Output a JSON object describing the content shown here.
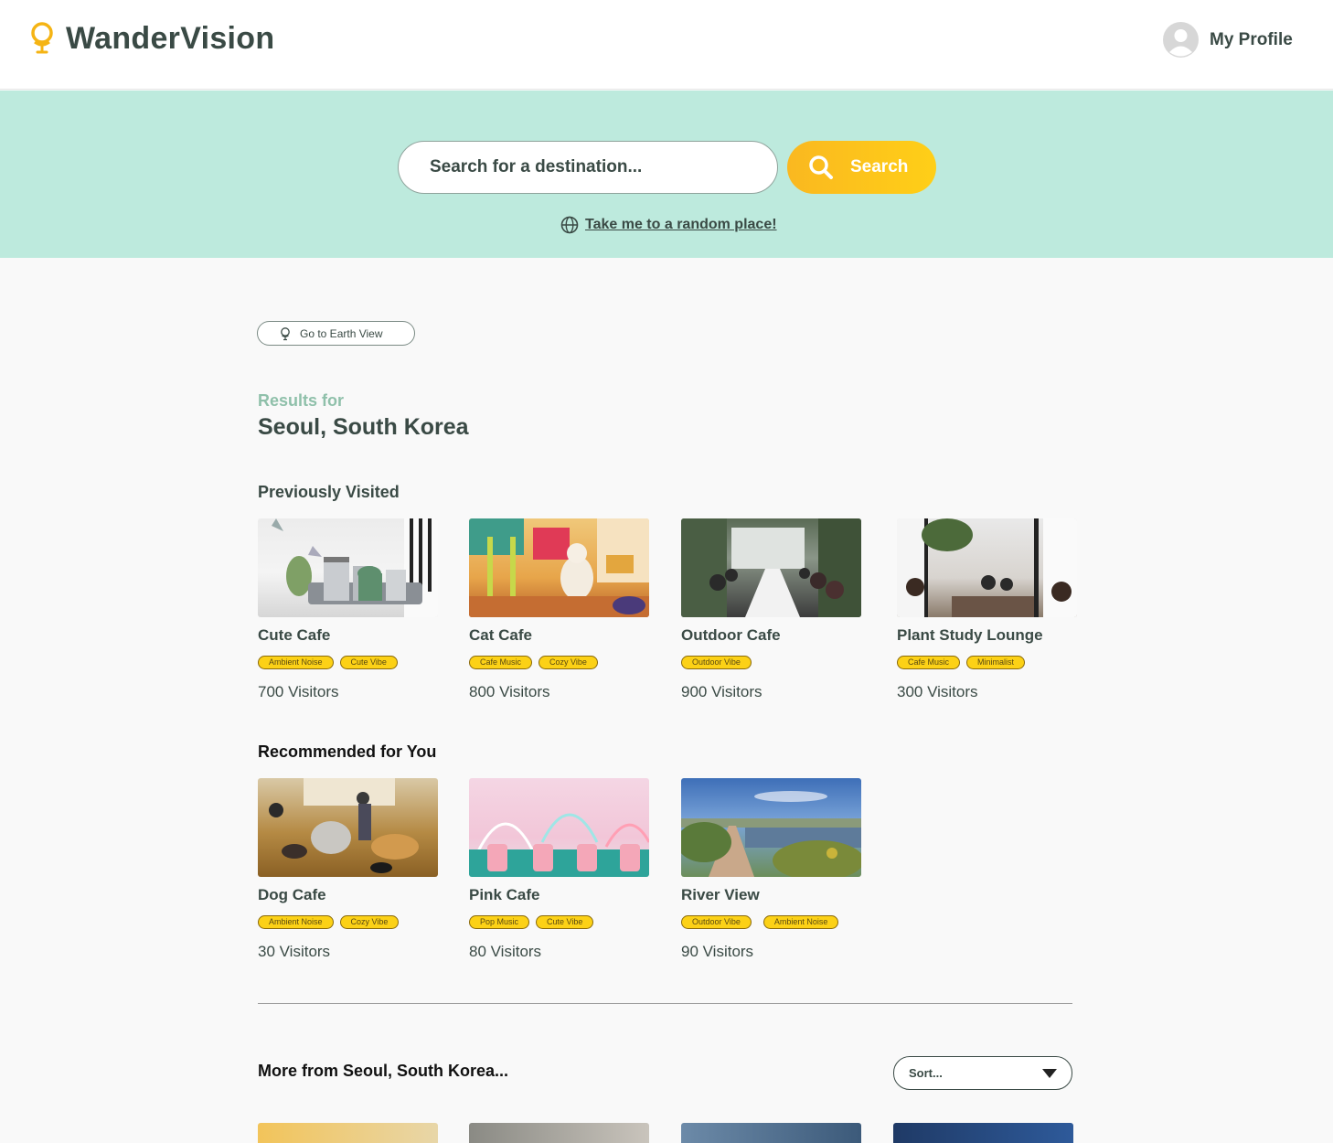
{
  "app": {
    "title": "WanderVision"
  },
  "profile": {
    "label": "My Profile"
  },
  "search": {
    "placeholder": "Search for a destination...",
    "button_label": "Search"
  },
  "random_link": {
    "label": "Take me to a random place!"
  },
  "earth_view": {
    "label": "Go to Earth View"
  },
  "results": {
    "prefix": "Results for",
    "location": "Seoul, South Korea"
  },
  "sections": {
    "previously_visited": {
      "title": "Previously Visited",
      "items": [
        {
          "name": "Cute Cafe",
          "tags": [
            "Ambient Noise",
            "Cute Vibe"
          ],
          "visitors": "700 Visitors"
        },
        {
          "name": "Cat Cafe",
          "tags": [
            "Cafe Music",
            "Cozy Vibe"
          ],
          "visitors": "800 Visitors"
        },
        {
          "name": "Outdoor Cafe",
          "tags": [
            "Outdoor Vibe"
          ],
          "visitors": "900 Visitors"
        },
        {
          "name": "Plant Study Lounge",
          "tags": [
            "Cafe Music",
            "Minimalist"
          ],
          "visitors": "300 Visitors"
        }
      ]
    },
    "recommended": {
      "title": "Recommended for You",
      "items": [
        {
          "name": "Dog Cafe",
          "tags": [
            "Ambient Noise",
            "Cozy Vibe"
          ],
          "visitors": "30 Visitors"
        },
        {
          "name": "Pink Cafe",
          "tags": [
            "Pop Music",
            "Cute Vibe"
          ],
          "visitors": "80 Visitors"
        },
        {
          "name": "River View",
          "tags": [
            "Outdoor Vibe",
            "Ambient Noise"
          ],
          "visitors": "90 Visitors"
        }
      ]
    },
    "more": {
      "title": "More from Seoul, South Korea..."
    }
  },
  "sort": {
    "label": "Sort..."
  },
  "colors": {
    "hero_bg": "#bdeadd",
    "accent_yellow": "#fcd116",
    "text_dark": "#3a4a45",
    "muted_green": "#8fc0aa"
  },
  "icons": [
    "globe-pin-logo-icon",
    "avatar-icon",
    "search-icon",
    "globe-icon",
    "globe-pin-icon",
    "chevron-down-icon"
  ]
}
